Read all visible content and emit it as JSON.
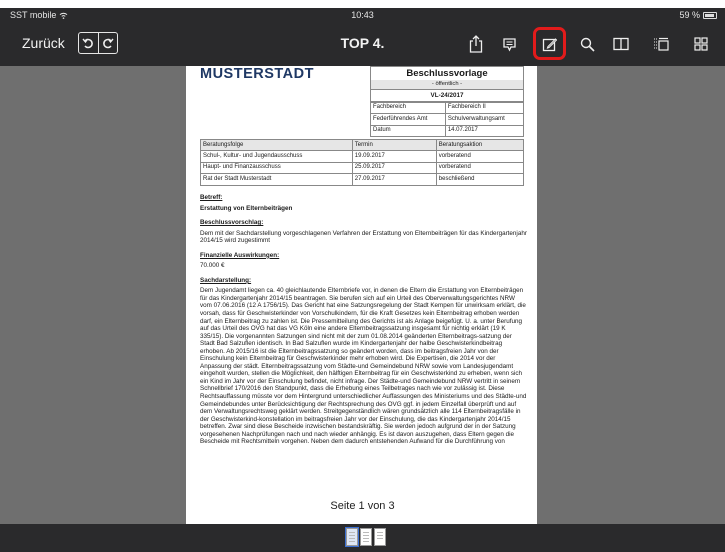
{
  "status": {
    "carrier": "SST mobile",
    "time": "10:43",
    "battery": "59 %"
  },
  "nav": {
    "back_label": "Zurück",
    "title": "TOP 4.",
    "icons": [
      "undo-icon",
      "redo-icon",
      "share-icon",
      "comment-icon",
      "edit-icon",
      "search-icon",
      "book-icon",
      "list-icon",
      "grid-icon"
    ],
    "highlight_color": "#e21b1b"
  },
  "document": {
    "logo": "MUSTERSTADT",
    "vorlage": {
      "title": "Beschlussvorlage",
      "visibility": "- öffentlich -",
      "number": "VL-24/2017",
      "rows": [
        {
          "label": "Fachbereich",
          "value": "Fachbereich II"
        },
        {
          "label": "Federführendes Amt",
          "value": "Schulverwaltungsamt"
        },
        {
          "label": "Datum",
          "value": "14.07.2017"
        }
      ]
    },
    "beratung": {
      "headers": [
        "Beratungsfolge",
        "Termin",
        "Beratungsaktion"
      ],
      "rows": [
        [
          "Schul-, Kultur- und Jugendausschuss",
          "19.09.2017",
          "vorberatend"
        ],
        [
          "Haupt- und Finanzausschuss",
          "25.09.2017",
          "vorberatend"
        ],
        [
          "Rat der Stadt Musterstadt",
          "27.09.2017",
          "beschließend"
        ]
      ]
    },
    "betreff_heading": "Betreff:",
    "betreff_text": "Erstattung von Elternbeiträgen",
    "beschluss_heading": "Beschlussvorschlag:",
    "beschluss_text": "Dem mit der Sachdarstellung vorgeschlagenen Verfahren der Erstattung von Elternbeiträgen für das Kindergartenjahr 2014/15 wird zugestimmt",
    "finanz_heading": "Finanzielle Auswirkungen:",
    "finanz_text": "70.000 €",
    "sach_heading": "Sachdarstellung:",
    "sach_text": "Dem Jugendamt liegen ca. 40 gleichlautende Elternbriefe vor, in denen die Eltern die Erstattung von Elternbeiträgen für das Kindergartenjahr 2014/15 beantragen. Sie berufen sich auf ein Urteil des Oberverwaltungsgerichtes NRW vom 07.06.2016 (12 A 1756/15). Das Gericht hat eine Satzungsregelung der Stadt Kempen für unwirksam erklärt, die vorsah, dass für Geschwisterkinder von Vorschulkindern, für die Kraft Gesetzes kein Elternbeitrag erhoben werden darf, ein Elternbeitrag zu zahlen ist. Die Pressemitteilung des Gerichts ist als Anlage beigefügt. U. a. unter Berufung auf das Urteil des OVG hat das VG Köln eine andere Elternbeitragssatzung insgesamt für nichtig erklärt (19 K 335/15). Die vorgenannten Satzungen sind nicht mit der zum 01.08.2014 geänderten Elternbeitrags-satzung der Stadt Bad Salzuflen identisch. In Bad Salzuflen wurde im Kindergartenjahr der halbe Geschwisterkindbeitrag erhoben. Ab 2015/16 ist die Elternbeitragssatzung so geändert worden, dass im beitragsfreien Jahr von der Einschulung kein Elternbeitrag für Geschwisterkinder mehr erhoben wird. Die Expertisen, die 2014 vor der Anpassung der städt. Elternbeitragssatzung vom Städte-und Gemeindebund NRW sowie vom Landesjugendamt eingeholt wurden, stellen die Möglichkeit, den hälftigen Elternbeitrag für ein Geschwisterkind zu erheben, wenn sich ein Kind im Jahr vor der Einschulung befindet, nicht infrage. Der Städte-und Gemeindebund NRW vertritt in seinem Schnellbrief 170/2016 den Standpunkt, dass die Erhebung eines Teilbetrages nach wie vor zulässig ist. Diese Rechtsauffassung müsste vor dem Hintergrund unterschiedlicher Auffassungen des Ministeriums und des Städte-und Gemeindebundes unter Berücksichtigung der Rechtsprechung des OVG ggf. in jedem Einzelfall überprüft und auf dem Verwaltungsrechtsweg geklärt werden. Streitgegenständlich wären grundsätzlich alle 114 Elternbeitragsfälle in der Geschwisterkind-konstellation im beitragsfreien Jahr vor der Einschulung, die das Kindergartenjahr 2014/15 betreffen. Zwar sind diese Bescheide inzwischen bestandskräftig. Sie werden jedoch aufgrund der in der Satzung vorgesehenen Nachprüfungen nach und nach wieder anhängig. Es ist davon auszugehen, dass Eltern gegen die Bescheide mit Rechtsmitteln vorgehen. Neben dem dadurch entstehenden Aufwand für die Durchführung von"
  },
  "page_indicator": "Seite 1 von 3",
  "thumbnails": [
    "page-1",
    "page-2",
    "page-3"
  ]
}
